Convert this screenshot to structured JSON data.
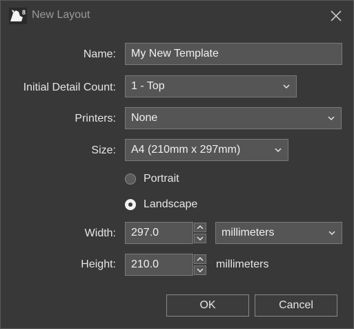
{
  "window": {
    "title": "New Layout"
  },
  "form": {
    "name_label": "Name:",
    "name_value": "My New Template",
    "detail_label": "Initial Detail Count:",
    "detail_value": "1 - Top",
    "printers_label": "Printers:",
    "printers_value": "None",
    "size_label": "Size:",
    "size_value": "A4 (210mm x 297mm)",
    "orientation": {
      "portrait_label": "Portrait",
      "landscape_label": "Landscape",
      "selected": "Landscape"
    },
    "width_label": "Width:",
    "width_value": "297.0",
    "width_unit": "millimeters",
    "height_label": "Height:",
    "height_value": "210.0",
    "height_unit": "millimeters"
  },
  "buttons": {
    "ok": "OK",
    "cancel": "Cancel"
  },
  "icons": {
    "app": "rhino-8-icon",
    "close": "close-icon",
    "dropdown": "chevron-down-icon",
    "spin_up": "chevron-up-icon",
    "spin_down": "chevron-down-icon"
  },
  "colors": {
    "background": "#383838",
    "field": "#555555",
    "border": "#7a7a7a",
    "text": "#e6e6e6"
  }
}
